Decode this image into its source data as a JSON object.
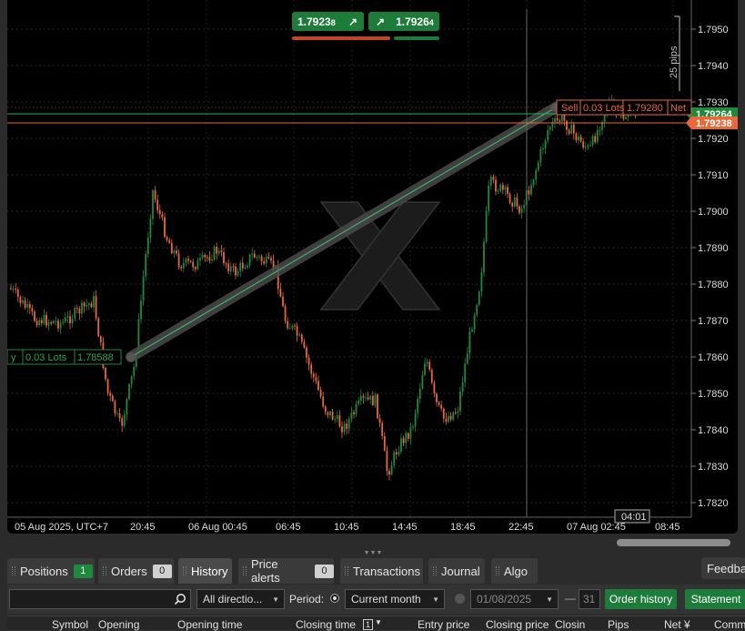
{
  "chart": {
    "sell_price": "1.7923",
    "sell_pip": "8",
    "buy_price": "1.7926",
    "buy_pip": "4",
    "price_axis": [
      "1.7950",
      "1.7940",
      "1.7930",
      "1.7920",
      "1.7910",
      "1.7900",
      "1.7890",
      "1.7880",
      "1.7870",
      "1.7860",
      "1.7850",
      "1.7840",
      "1.7830",
      "1.7820"
    ],
    "time_axis": [
      "05 Aug 2025, UTC+7",
      "20:45",
      "06 Aug 00:45",
      "06:45",
      "10:45",
      "14:45",
      "18:45",
      "22:45",
      "07 Aug 02:45",
      "08:45"
    ],
    "ask_price_tag": "1.79264",
    "bid_price_tag": "1.79238",
    "ruler_label": "25 pips",
    "crosshair_time": "04:01",
    "buy_order": {
      "side": "y",
      "lots": "0.03 Lots",
      "price": "1.78588"
    },
    "sell_order": {
      "side": "Sell",
      "lots": "0.03 Lots",
      "price": "1.79280",
      "net": "Net"
    },
    "colors": {
      "bull": "#1e8a3d",
      "bear": "#e8683a",
      "ask_line": "#2aa84f",
      "bid_line": "#e8683a"
    }
  },
  "tabs": [
    {
      "label": "Positions",
      "badge": "1"
    },
    {
      "label": "Orders",
      "badge": "0"
    },
    {
      "label": "History"
    },
    {
      "label": "Price alerts",
      "badge": "0"
    },
    {
      "label": "Transactions"
    },
    {
      "label": "Journal"
    },
    {
      "label": "Algo"
    }
  ],
  "feedback_label": "Feedba",
  "filters": {
    "direction": "All directio...",
    "period_label": "Period:",
    "period": "Current month",
    "date_from": "01/08/2025",
    "date_to": "31",
    "order_history_btn": "Order history",
    "statement_btn": "Statement"
  },
  "columns": [
    "Symbol",
    "Opening",
    "Opening time",
    "Closing time",
    "1",
    "Entry price",
    "Closing price",
    "Closin",
    "Pips",
    "Net ¥",
    "Comm"
  ]
}
